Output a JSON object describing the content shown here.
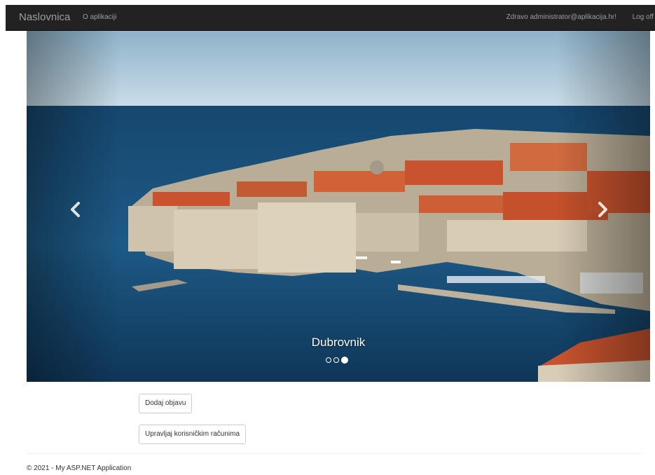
{
  "navbar": {
    "brand": "Naslovnica",
    "about": "O aplikaciji",
    "greeting": "Zdravo administrator@aplikacija.hr!",
    "logoff": "Log off"
  },
  "carousel": {
    "caption": "Dubrovnik",
    "slide_count": 3,
    "active_index": 2,
    "prev_icon": "chevron-left-icon",
    "next_icon": "chevron-right-icon"
  },
  "actions": {
    "add_post": "Dodaj objavu",
    "manage_accounts": "Upravljaj korisničkim računima"
  },
  "footer": {
    "text": "© 2021 - My ASP.NET Application"
  },
  "colors": {
    "navbar_bg": "#222222",
    "navbar_text": "#9d9d9d",
    "sea": "#1d5a86",
    "roofs": "#c8532e",
    "walls": "#cfc3ae"
  }
}
